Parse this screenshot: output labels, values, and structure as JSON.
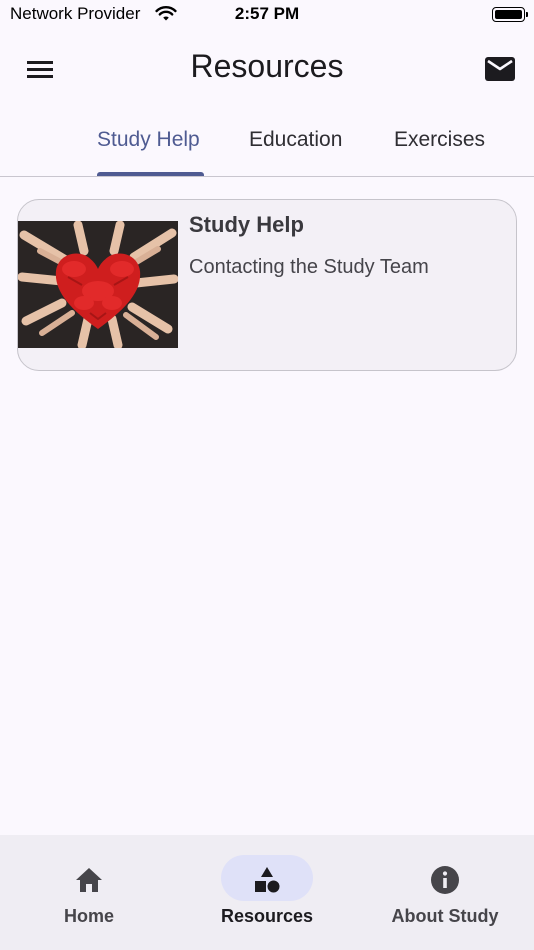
{
  "status_bar": {
    "carrier": "Network Provider",
    "time": "2:57 PM",
    "icons": [
      "wifi-icon",
      "battery-icon"
    ]
  },
  "app_bar": {
    "title": "Resources",
    "left_icon": "menu-icon",
    "right_icon": "mail-icon"
  },
  "tabs": [
    {
      "label": "Study Help",
      "selected": true
    },
    {
      "label": "Education",
      "selected": false
    },
    {
      "label": "Exercises",
      "selected": false
    }
  ],
  "resource_cards": [
    {
      "title": "Study Help",
      "subtitle": "Contacting the Study Team",
      "image": "red-painted-hands-heart-photo"
    }
  ],
  "bottom_nav": [
    {
      "label": "Home",
      "icon": "home-icon",
      "selected": false
    },
    {
      "label": "Resources",
      "icon": "shapes-icon",
      "selected": true
    },
    {
      "label": "About Study",
      "icon": "info-icon",
      "selected": false
    }
  ],
  "colors": {
    "background": "#fbf8fe",
    "accent": "#4f5b92",
    "card_background": "#f3f0f6",
    "nav_background": "#efedf3",
    "nav_active_pill": "#dfe1f8"
  }
}
